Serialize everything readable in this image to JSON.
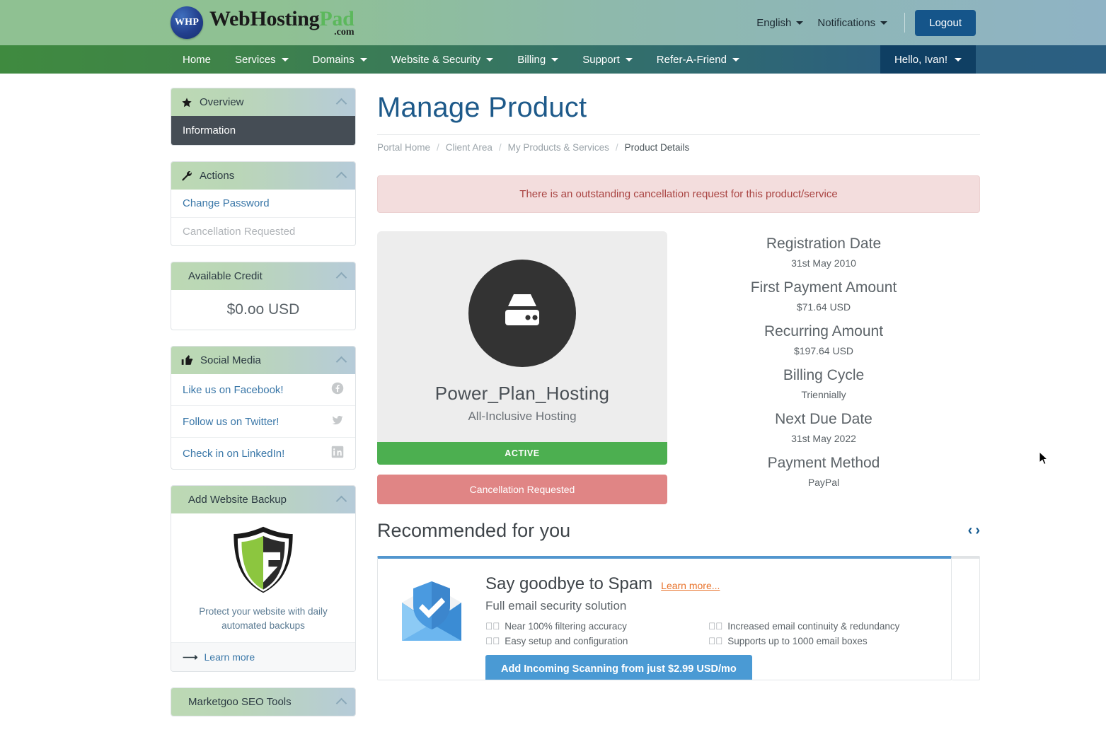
{
  "header": {
    "logo": {
      "badge": "WHP",
      "name_1": "WebHosting",
      "name_2": "Pad",
      "tld": ".com"
    },
    "language": "English",
    "notifications": "Notifications",
    "logout": "Logout"
  },
  "nav": {
    "items": [
      {
        "label": "Home",
        "caret": false
      },
      {
        "label": "Services",
        "caret": true
      },
      {
        "label": "Domains",
        "caret": true
      },
      {
        "label": "Website & Security",
        "caret": true
      },
      {
        "label": "Billing",
        "caret": true
      },
      {
        "label": "Support",
        "caret": true
      },
      {
        "label": "Refer-A-Friend",
        "caret": true
      }
    ],
    "user": "Hello, Ivan!"
  },
  "sidebar": {
    "overview": {
      "title": "Overview",
      "icon": "star-icon",
      "items": [
        {
          "label": "Information",
          "state": "active"
        }
      ]
    },
    "actions": {
      "title": "Actions",
      "icon": "wrench-icon",
      "items": [
        {
          "label": "Change Password",
          "state": "normal"
        },
        {
          "label": "Cancellation Requested",
          "state": "muted"
        }
      ]
    },
    "credit": {
      "title": "Available Credit",
      "amount": "$0.oo USD"
    },
    "social": {
      "title": "Social Media",
      "icon": "thumbs-up-icon",
      "items": [
        {
          "label": "Like us on Facebook!",
          "icon": "facebook-icon"
        },
        {
          "label": "Follow us on Twitter!",
          "icon": "twitter-icon"
        },
        {
          "label": "Check in on LinkedIn!",
          "icon": "linkedin-icon"
        }
      ]
    },
    "backup": {
      "title": "Add Website Backup",
      "caption": "Protect your website with daily automated backups",
      "link": "Learn more"
    },
    "marketgoo": {
      "title": "Marketgoo SEO Tools"
    }
  },
  "main": {
    "title": "Manage Product",
    "breadcrumb": [
      {
        "label": "Portal Home",
        "current": false
      },
      {
        "label": "Client Area",
        "current": false
      },
      {
        "label": "My Products & Services",
        "current": false
      },
      {
        "label": "Product Details",
        "current": true
      }
    ],
    "alert": "There is an outstanding cancellation request for this product/service",
    "product": {
      "icon": "server-icon",
      "name": "Power_Plan_Hosting",
      "subtitle": "All-Inclusive Hosting",
      "status": "ACTIVE",
      "action_button": "Cancellation Requested"
    },
    "details": [
      {
        "label": "Registration Date",
        "value": "31st May 2010"
      },
      {
        "label": "First Payment Amount",
        "value": "$71.64 USD"
      },
      {
        "label": "Recurring Amount",
        "value": "$197.64 USD"
      },
      {
        "label": "Billing Cycle",
        "value": "Triennially"
      },
      {
        "label": "Next Due Date",
        "value": "31st May 2022"
      },
      {
        "label": "Payment Method",
        "value": "PayPal"
      }
    ],
    "recommended": {
      "title": "Recommended for you",
      "prev_icon": "chevron-left-icon",
      "next_icon": "chevron-right-icon",
      "card": {
        "image": "email-shield-icon",
        "heading": "Say goodbye to Spam",
        "learn_more": "Learn more...",
        "subheading": "Full email security solution",
        "features": [
          "Near 100% filtering accuracy",
          "Increased email continuity & redundancy",
          "Easy setup and configuration",
          "Supports up to 1000 email boxes"
        ],
        "cta": "Add Incoming Scanning from just $2.99 USD/mo"
      }
    }
  },
  "colors": {
    "brand_green": "#5cb85c",
    "brand_blue": "#15558a",
    "status_active": "#4caf50",
    "alert_bg": "#f3dddd",
    "alert_text": "#a94442",
    "cancel_btn": "#e08585",
    "cta_blue": "#4a9ad4",
    "link_orange": "#e8722a"
  }
}
